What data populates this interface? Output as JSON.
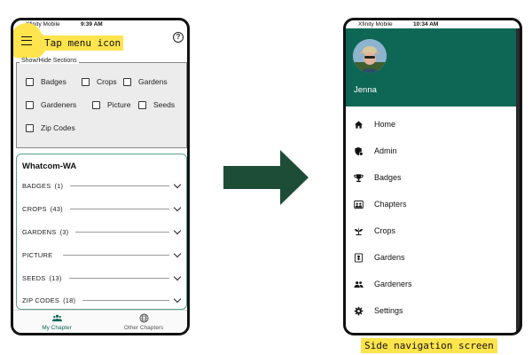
{
  "callouts": {
    "tap_menu": "Tap menu icon",
    "side_nav": "Side navigation screen"
  },
  "left_phone": {
    "status": {
      "carrier": "Xfinity Mobile",
      "time": "9:39 AM"
    },
    "help_icon_glyph": "?",
    "show_hide": {
      "legend": "Show/Hide Sections",
      "options": [
        "Badges",
        "Crops",
        "Gardens",
        "Gardeners",
        "Picture",
        "Seeds",
        "Zip Codes"
      ]
    },
    "chapter": {
      "title": "Whatcom-WA",
      "sections": [
        {
          "label": "BADGES",
          "count": "(1)"
        },
        {
          "label": "CROPS",
          "count": "(43)"
        },
        {
          "label": "GARDENS",
          "count": "(3)"
        },
        {
          "label": "PICTURE",
          "count": ""
        },
        {
          "label": "SEEDS",
          "count": "(13)"
        },
        {
          "label": "ZIP CODES",
          "count": "(18)"
        }
      ]
    },
    "bottom_nav": [
      {
        "label": "My Chapter",
        "icon": "people-icon",
        "active": true
      },
      {
        "label": "Other Chapters",
        "icon": "globe-icon",
        "active": false
      }
    ]
  },
  "right_phone": {
    "status": {
      "carrier": "Xfinity Mobile",
      "time": "10:34 AM"
    },
    "user_name": "Jenna",
    "header_color": "#0e6655",
    "menu": [
      {
        "label": "Home",
        "icon": "home-icon"
      },
      {
        "label": "Admin",
        "icon": "admin-shield-icon"
      },
      {
        "label": "Badges",
        "icon": "trophy-icon"
      },
      {
        "label": "Chapters",
        "icon": "chapters-icon"
      },
      {
        "label": "Crops",
        "icon": "sprout-icon"
      },
      {
        "label": "Gardens",
        "icon": "garden-icon"
      },
      {
        "label": "Gardeners",
        "icon": "people-icon"
      },
      {
        "label": "Settings",
        "icon": "gear-icon"
      }
    ]
  },
  "colors": {
    "accent": "#0e6655",
    "highlight": "#ffe44d",
    "arrow": "#1e4d37"
  }
}
